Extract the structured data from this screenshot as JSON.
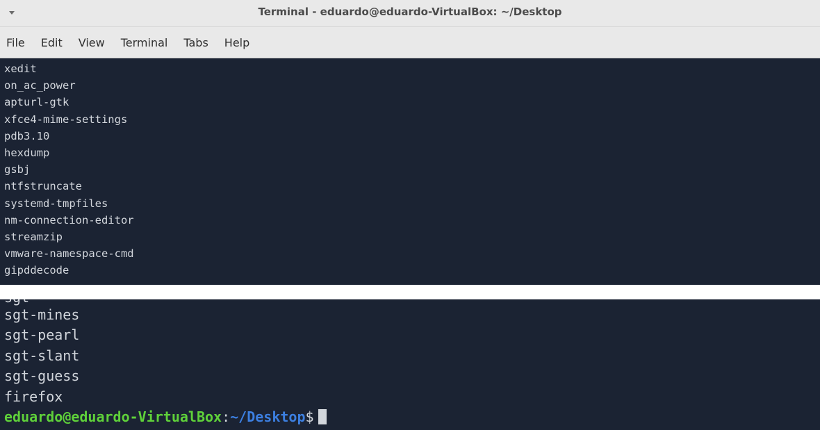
{
  "window": {
    "title": "Terminal - eduardo@eduardo-VirtualBox: ~/Desktop"
  },
  "menubar": {
    "items": [
      "File",
      "Edit",
      "View",
      "Terminal",
      "Tabs",
      "Help"
    ]
  },
  "terminal_top": {
    "lines": [
      "xedit",
      "on_ac_power",
      "apturl-gtk",
      "xfce4-mime-settings",
      "pdb3.10",
      "hexdump",
      "gsbj",
      "ntfstruncate",
      "systemd-tmpfiles",
      "nm-connection-editor",
      "streamzip",
      "vmware-namespace-cmd",
      "gipddecode"
    ]
  },
  "terminal_bottom": {
    "cutoff_line": "sgt-",
    "lines": [
      "sgt-mines",
      "sgt-pearl",
      "sgt-slant",
      "sgt-guess",
      "firefox"
    ],
    "prompt": {
      "user_host": "eduardo@eduardo-VirtualBox",
      "colon": ":",
      "path": "~/Desktop",
      "symbol": "$"
    }
  },
  "colors": {
    "terminal_bg": "#1b2333",
    "terminal_fg": "#d2d6dc",
    "prompt_user": "#5fd13a",
    "prompt_path": "#3c7fe0",
    "chrome_bg": "#e9e9e9"
  }
}
